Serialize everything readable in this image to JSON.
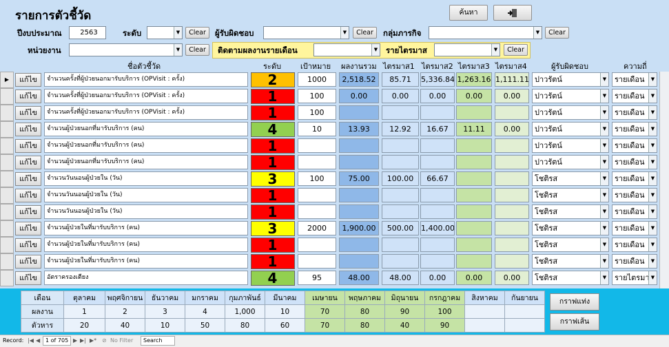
{
  "header": {
    "title": "รายการตัวชี้วัด",
    "search_label": "ค้นหา",
    "exit_icon": "exit-door-icon",
    "budget_year_label": "ปีงบประมาณ",
    "budget_year_value": "2563",
    "level_label": "ระดับ",
    "responsible_label": "ผู้รับผิดชอบ",
    "mission_label": "กลุ่มภารกิจ",
    "unit_label": "หน่วยงาน",
    "monthly_label": "ติดตามผลงานรายเดือน",
    "quarter_label": "รายไตรมาส",
    "clear_label": "Clear"
  },
  "columns": {
    "name": "ชื่อตัวชี้วัด",
    "level": "ระดับ",
    "target": "เป้าหมาย",
    "total": "ผลงานรวม",
    "q1": "ไตรมาส1",
    "q2": "ไตรมาส2",
    "q3": "ไตรมาส3",
    "q4": "ไตรมาส4",
    "responsible": "ผู้รับผิดชอบ",
    "frequency": "ความถี่"
  },
  "edit_label": "แก้ไข",
  "level_colors": {
    "1": "#ff0000",
    "2": "#ffc000",
    "3": "#ffff00",
    "4": "#92d050"
  },
  "rows": [
    {
      "name": "จำนวนครั้งที่ผู้ป่วยนอกมารับบริการ (OPVisit : ครั้ง)",
      "level": "2",
      "target": "1000",
      "total": "2,518.52",
      "q1": "85.71",
      "q2": "5,336.84",
      "q3": "1,263.16",
      "q4": "1,111.11",
      "responsible": "ปาวรัตน์",
      "frequency": "รายเดือน"
    },
    {
      "name": "จำนวนครั้งที่ผู้ป่วยนอกมารับบริการ (OPVisit : ครั้ง)",
      "level": "1",
      "target": "100",
      "total": "0.00",
      "q1": "0.00",
      "q2": "0.00",
      "q3": "0.00",
      "q4": "0.00",
      "responsible": "ปาวรัตน์",
      "frequency": "รายเดือน"
    },
    {
      "name": "จำนวนครั้งที่ผู้ป่วยนอกมารับบริการ (OPVisit : ครั้ง)",
      "level": "1",
      "target": "100",
      "total": "",
      "q1": "",
      "q2": "",
      "q3": "",
      "q4": "",
      "responsible": "ปาวรัตน์",
      "frequency": "รายเดือน"
    },
    {
      "name": "จำนวนผู้ป่วยนอกที่มารับบริการ (คน)",
      "level": "4",
      "target": "10",
      "total": "13.93",
      "q1": "12.92",
      "q2": "16.67",
      "q3": "11.11",
      "q4": "0.00",
      "responsible": "ปาวรัตน์",
      "frequency": "รายเดือน"
    },
    {
      "name": "จำนวนผู้ป่วยนอกที่มารับบริการ (คน)",
      "level": "1",
      "target": "",
      "total": "",
      "q1": "",
      "q2": "",
      "q3": "",
      "q4": "",
      "responsible": "ปาวรัตน์",
      "frequency": "รายเดือน"
    },
    {
      "name": "จำนวนผู้ป่วยนอกที่มารับบริการ (คน)",
      "level": "1",
      "target": "",
      "total": "",
      "q1": "",
      "q2": "",
      "q3": "",
      "q4": "",
      "responsible": "ปาวรัตน์",
      "frequency": "รายเดือน"
    },
    {
      "name": "จำนวนวันนอนผู้ป่วยใน (วัน)",
      "level": "3",
      "target": "100",
      "total": "75.00",
      "q1": "100.00",
      "q2": "66.67",
      "q3": "",
      "q4": "",
      "responsible": "โชติรส",
      "frequency": "รายเดือน"
    },
    {
      "name": "จำนวนวันนอนผู้ป่วยใน (วัน)",
      "level": "1",
      "target": "",
      "total": "",
      "q1": "",
      "q2": "",
      "q3": "",
      "q4": "",
      "responsible": "โชติรส",
      "frequency": "รายเดือน"
    },
    {
      "name": "จำนวนวันนอนผู้ป่วยใน (วัน)",
      "level": "1",
      "target": "",
      "total": "",
      "q1": "",
      "q2": "",
      "q3": "",
      "q4": "",
      "responsible": "โชติรส",
      "frequency": "รายเดือน"
    },
    {
      "name": "จำนวนผู้ป่วยในที่มารับบริการ (คน)",
      "level": "3",
      "target": "2000",
      "total": "1,900.00",
      "q1": "500.00",
      "q2": "1,400.00",
      "q3": "",
      "q4": "",
      "responsible": "โชติรส",
      "frequency": "รายเดือน"
    },
    {
      "name": "จำนวนผู้ป่วยในที่มารับบริการ (คน)",
      "level": "1",
      "target": "",
      "total": "",
      "q1": "",
      "q2": "",
      "q3": "",
      "q4": "",
      "responsible": "โชติรส",
      "frequency": "รายเดือน"
    },
    {
      "name": "จำนวนผู้ป่วยในที่มารับบริการ (คน)",
      "level": "1",
      "target": "",
      "total": "",
      "q1": "",
      "q2": "",
      "q3": "",
      "q4": "",
      "responsible": "โชติรส",
      "frequency": "รายเดือน"
    },
    {
      "name": "อัตราครองเตียง",
      "level": "4",
      "target": "95",
      "total": "48.00",
      "q1": "48.00",
      "q2": "0.00",
      "q3": "0.00",
      "q4": "0.00",
      "responsible": "โชติรส",
      "frequency": "รายไตรมาส"
    }
  ],
  "monthly": {
    "month_label": "เดือน",
    "result_label": "ผลงาน",
    "divisor_label": "ตัวหาร",
    "months": [
      "ตุลาคม",
      "พฤศจิกายน",
      "ธันวาคม",
      "มกราคม",
      "กุมภาพันธ์",
      "มีนาคม",
      "เมษายน",
      "พฤษภาคม",
      "มิถุนายน",
      "กรกฎาคม",
      "สิงหาคม",
      "กันยายน"
    ],
    "results": [
      "1",
      "2",
      "3",
      "4",
      "1,000",
      "10",
      "70",
      "80",
      "90",
      "100",
      "",
      ""
    ],
    "divisors": [
      "20",
      "40",
      "10",
      "50",
      "80",
      "60",
      "70",
      "80",
      "40",
      "90",
      "",
      ""
    ]
  },
  "chart_buttons": {
    "bar": "กราฟแท่ง",
    "line": "กราฟเส้น"
  },
  "status": {
    "record_label": "Record:",
    "record_value": "1 of 705",
    "filter_label": "No Filter",
    "search_label": "Search"
  }
}
